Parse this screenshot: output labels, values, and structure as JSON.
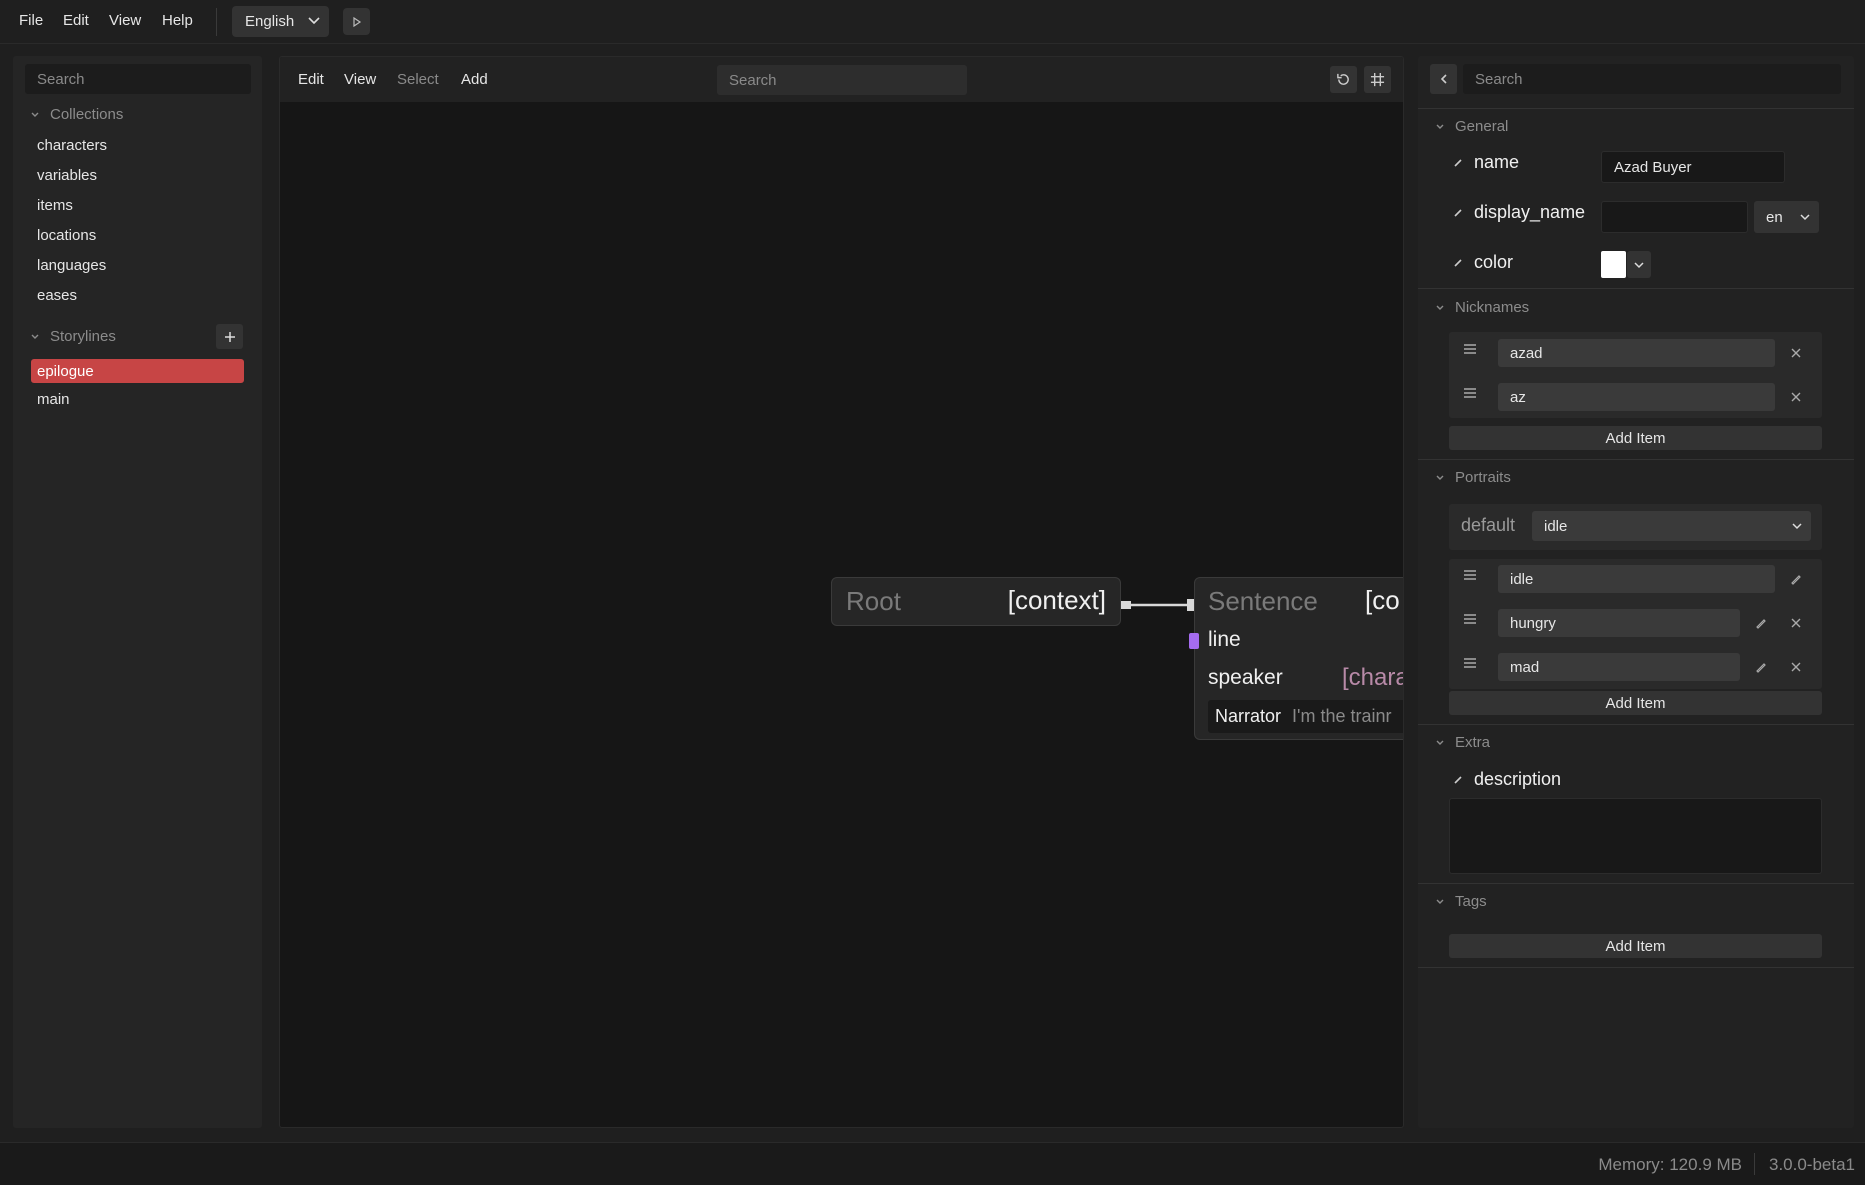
{
  "menubar": {
    "items": [
      "File",
      "Edit",
      "View",
      "Help"
    ],
    "language": "English"
  },
  "sidebar": {
    "search_placeholder": "Search",
    "collections_label": "Collections",
    "collections": [
      "characters",
      "variables",
      "items",
      "locations",
      "languages",
      "eases"
    ],
    "storylines_label": "Storylines",
    "storylines": [
      "epilogue",
      "main"
    ],
    "active_storyline": "epilogue"
  },
  "canvas": {
    "toolbar": {
      "edit": "Edit",
      "view": "View",
      "select": "Select",
      "add": "Add"
    },
    "search_placeholder": "Search",
    "root_node": {
      "title": "Root",
      "context": "[context]"
    },
    "sentence_node": {
      "title": "Sentence",
      "context": "[co",
      "line_label": "line",
      "speaker_label": "speaker",
      "speaker_type": "[chara",
      "preview_speaker": "Narrator",
      "preview_text": "I'm the trainr"
    },
    "colors": {
      "line_port": "#a56cf0",
      "speaker_type": "#b88aa8"
    }
  },
  "inspector": {
    "search_placeholder": "Search",
    "general": {
      "label": "General",
      "name_label": "name",
      "name_value": "Azad Buyer",
      "display_name_label": "display_name",
      "display_name_value": "",
      "locale": "en",
      "color_label": "color",
      "color_value": "#ffffff"
    },
    "nicknames": {
      "label": "Nicknames",
      "items": [
        "azad",
        "az"
      ],
      "add_label": "Add Item"
    },
    "portraits": {
      "label": "Portraits",
      "default_label": "default",
      "default_value": "idle",
      "items": [
        "idle",
        "hungry",
        "mad"
      ],
      "add_label": "Add Item"
    },
    "extra": {
      "label": "Extra",
      "description_label": "description",
      "description_value": ""
    },
    "tags": {
      "label": "Tags",
      "add_label": "Add Item"
    }
  },
  "status": {
    "memory": "Memory: 120.9 MB",
    "version": "3.0.0-beta1"
  },
  "colors": {
    "accent": "#c74545",
    "background": "#1f1f1f"
  }
}
